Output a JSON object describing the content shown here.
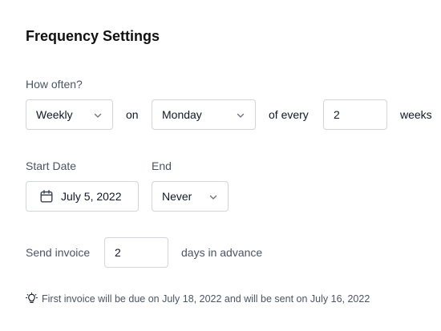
{
  "title": "Frequency Settings",
  "frequency": {
    "label": "How often?",
    "period": "Weekly",
    "on_text": "on",
    "day": "Monday",
    "of_every_text": "of every",
    "interval": "2",
    "unit_text": "weeks"
  },
  "start_date": {
    "label": "Start Date",
    "value": "July 5, 2022"
  },
  "end": {
    "label": "End",
    "value": "Never"
  },
  "send_invoice": {
    "label": "Send invoice",
    "days": "2",
    "suffix": "days in advance"
  },
  "note": {
    "text": "First invoice will be due on July 18, 2022 and will be sent on July 16, 2022"
  },
  "icons": [
    "chevron-down-icon",
    "calendar-icon",
    "lightbulb-icon"
  ]
}
